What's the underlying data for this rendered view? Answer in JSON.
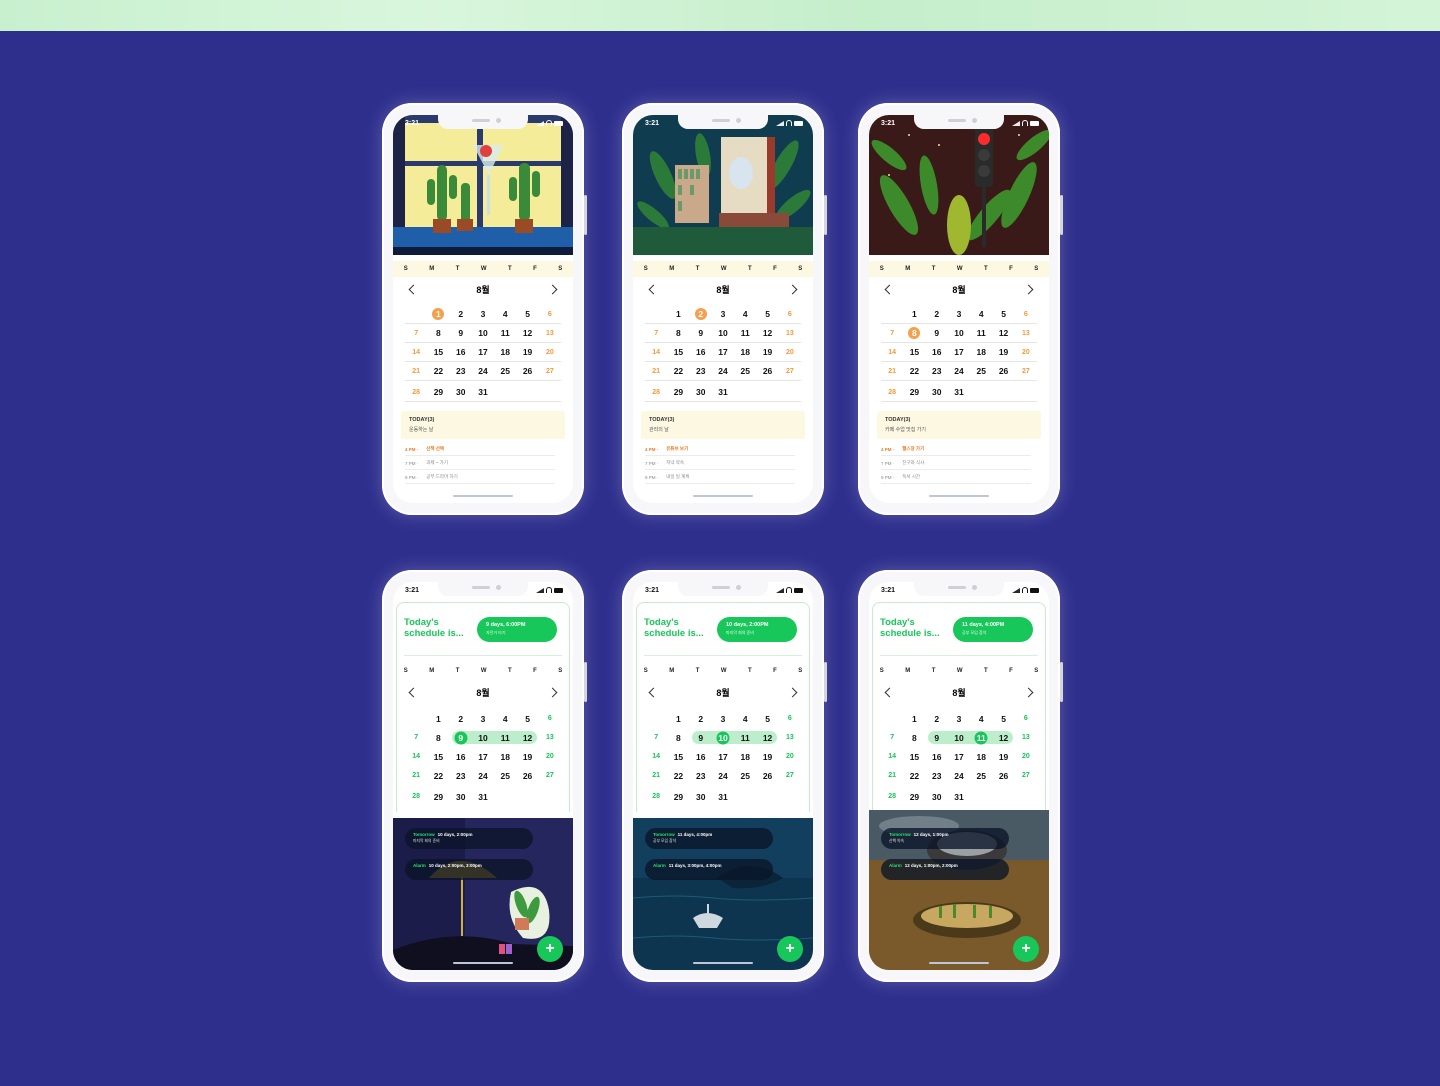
{
  "time": "3:21",
  "dow": [
    "S",
    "M",
    "T",
    "W",
    "T",
    "F",
    "S"
  ],
  "month": "8월",
  "weeks": [
    [
      "",
      "",
      "1",
      "2",
      "3",
      "4",
      "5",
      "6"
    ],
    [
      "7",
      "8",
      "9",
      "10",
      "11",
      "12",
      "13"
    ],
    [
      "14",
      "15",
      "16",
      "17",
      "18",
      "19",
      "20"
    ],
    [
      "21",
      "22",
      "23",
      "24",
      "25",
      "26",
      "27"
    ],
    [
      "28",
      "29",
      "30",
      "31",
      "",
      "",
      ""
    ]
  ],
  "top": [
    {
      "selected": "1",
      "today_title": "TODAY(3)",
      "today_sub": "운동하는 날",
      "events": [
        {
          "t": "4 PM ·",
          "d": "산책 선택"
        },
        {
          "t": "7 PM ·",
          "d": "과제 ~ 가기"
        },
        {
          "t": "9 PM ·",
          "d": "공부 드라마 하기"
        }
      ]
    },
    {
      "selected": "2",
      "today_title": "TODAY(3)",
      "today_sub": "관리의 날",
      "events": [
        {
          "t": "4 PM ·",
          "d": "유튜브 보기"
        },
        {
          "t": "7 PM ·",
          "d": "저녁 약속"
        },
        {
          "t": "9 PM ·",
          "d": "내일 일 계획"
        }
      ]
    },
    {
      "selected": "8",
      "today_title": "TODAY(3)",
      "today_sub": "카페 수업 맛집 가기",
      "events": [
        {
          "t": "4 PM ·",
          "d": "헬스장 가기"
        },
        {
          "t": "7 PM ·",
          "d": "친구와 식사"
        },
        {
          "t": "9 PM ·",
          "d": "독서 시간"
        }
      ]
    }
  ],
  "bottom": [
    {
      "title": "Today's schedule is...",
      "pill_main": "9 days, 6:00PM",
      "pill_sub": "자전거 타기",
      "selected": "9",
      "range": [
        "9",
        "12"
      ],
      "card1_a": "Tomorrow",
      "card1_b": "10 days, 2:00pm",
      "card1_c": "마지막 회의 준비",
      "card2_a": "Alarm",
      "card2_b": "10 days, 2:00pm, 3:00pm",
      "fab": "+"
    },
    {
      "title": "Today's schedule is...",
      "pill_main": "10 days, 2:00PM",
      "pill_sub": "마지막 회의 준비",
      "selected": "10",
      "range": [
        "9",
        "12"
      ],
      "card1_a": "Tomorrow",
      "card1_b": "11 days, 4:00pm",
      "card1_c": "공부 모임 참석",
      "card2_a": "Alarm",
      "card2_b": "11 days, 3:00pm, 4:00pm",
      "fab": "+"
    },
    {
      "title": "Today's schedule is...",
      "pill_main": "11 days, 4:00PM",
      "pill_sub": "공부 모임 참석",
      "selected": "11",
      "range": [
        "9",
        "12"
      ],
      "card1_a": "Tomorrow",
      "card1_b": "12 days, 1:00pm",
      "card1_c": "산책 약속",
      "card2_a": "Alarm",
      "card2_b": "12 days, 1:00pm, 2:00pm",
      "fab": "+"
    }
  ]
}
